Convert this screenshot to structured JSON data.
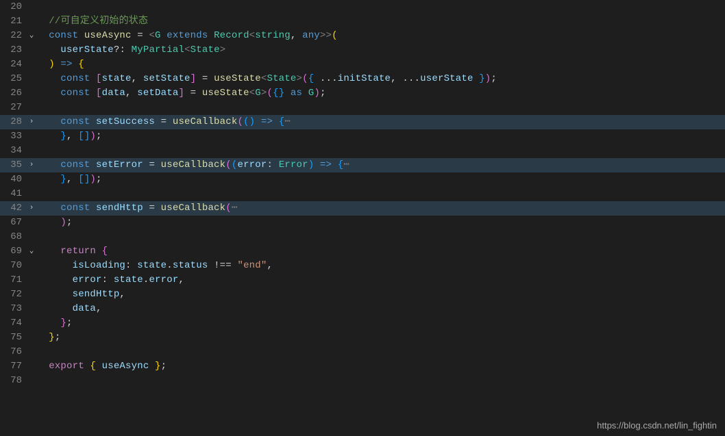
{
  "watermark": "https://blog.csdn.net/lin_fightin",
  "fold_icons": {
    "collapsed": "›",
    "expanded": "⌄"
  },
  "lines": [
    {
      "num": "20",
      "fold": "",
      "hl": false,
      "tokens": [
        [
          "",
          ""
        ]
      ]
    },
    {
      "num": "21",
      "fold": "",
      "hl": false,
      "tokens": [
        [
          "  ",
          ""
        ],
        [
          "//可自定义初始的状态",
          "c-comment"
        ]
      ]
    },
    {
      "num": "22",
      "fold": "expanded",
      "hl": false,
      "tokens": [
        [
          "  ",
          ""
        ],
        [
          "const ",
          "c-const"
        ],
        [
          "useAsync ",
          "c-func"
        ],
        [
          "= ",
          "c-punct"
        ],
        [
          "<",
          "c-gray"
        ],
        [
          "G ",
          "c-type"
        ],
        [
          "extends ",
          "c-const"
        ],
        [
          "Record",
          "c-type"
        ],
        [
          "<",
          "c-gray"
        ],
        [
          "string",
          "c-type"
        ],
        [
          ", ",
          "c-punct"
        ],
        [
          "any",
          "c-const"
        ],
        [
          ">>",
          "c-gray"
        ],
        [
          "(",
          "c-yellow"
        ]
      ]
    },
    {
      "num": "23",
      "fold": "",
      "hl": false,
      "tokens": [
        [
          "    ",
          ""
        ],
        [
          "userState",
          "c-var"
        ],
        [
          "?",
          "c-punct"
        ],
        [
          ": ",
          "c-punct"
        ],
        [
          "MyPartial",
          "c-type"
        ],
        [
          "<",
          "c-gray"
        ],
        [
          "State",
          "c-type"
        ],
        [
          ">",
          "c-gray"
        ]
      ]
    },
    {
      "num": "24",
      "fold": "",
      "hl": false,
      "tokens": [
        [
          "  ",
          ""
        ],
        [
          ") ",
          "c-yellow"
        ],
        [
          "=> ",
          "c-const"
        ],
        [
          "{",
          "c-yellow"
        ]
      ]
    },
    {
      "num": "25",
      "fold": "",
      "hl": false,
      "tokens": [
        [
          "    ",
          ""
        ],
        [
          "const ",
          "c-const"
        ],
        [
          "[",
          "c-magenta"
        ],
        [
          "state",
          "c-var"
        ],
        [
          ", ",
          "c-punct"
        ],
        [
          "setState",
          "c-var"
        ],
        [
          "] ",
          "c-magenta"
        ],
        [
          "= ",
          "c-punct"
        ],
        [
          "useState",
          "c-func"
        ],
        [
          "<",
          "c-gray"
        ],
        [
          "State",
          "c-type"
        ],
        [
          ">",
          "c-gray"
        ],
        [
          "(",
          "c-magenta"
        ],
        [
          "{ ",
          "c-cyan"
        ],
        [
          "...",
          "c-punct"
        ],
        [
          "initState",
          "c-var"
        ],
        [
          ", ",
          "c-punct"
        ],
        [
          "...",
          "c-punct"
        ],
        [
          "userState ",
          "c-var"
        ],
        [
          "}",
          "c-cyan"
        ],
        [
          ")",
          "c-magenta"
        ],
        [
          ";",
          "c-punct"
        ]
      ]
    },
    {
      "num": "26",
      "fold": "",
      "hl": false,
      "tokens": [
        [
          "    ",
          ""
        ],
        [
          "const ",
          "c-const"
        ],
        [
          "[",
          "c-magenta"
        ],
        [
          "data",
          "c-var"
        ],
        [
          ", ",
          "c-punct"
        ],
        [
          "setData",
          "c-var"
        ],
        [
          "] ",
          "c-magenta"
        ],
        [
          "= ",
          "c-punct"
        ],
        [
          "useState",
          "c-func"
        ],
        [
          "<",
          "c-gray"
        ],
        [
          "G",
          "c-type"
        ],
        [
          ">",
          "c-gray"
        ],
        [
          "(",
          "c-magenta"
        ],
        [
          "{} ",
          "c-cyan"
        ],
        [
          "as ",
          "c-const"
        ],
        [
          "G",
          "c-type"
        ],
        [
          ")",
          "c-magenta"
        ],
        [
          ";",
          "c-punct"
        ]
      ]
    },
    {
      "num": "27",
      "fold": "",
      "hl": false,
      "tokens": [
        [
          "",
          ""
        ]
      ]
    },
    {
      "num": "28",
      "fold": "collapsed",
      "hl": true,
      "tokens": [
        [
          "    ",
          ""
        ],
        [
          "const ",
          "c-const"
        ],
        [
          "setSuccess ",
          "c-var"
        ],
        [
          "= ",
          "c-punct"
        ],
        [
          "useCallback",
          "c-func"
        ],
        [
          "(",
          "c-magenta"
        ],
        [
          "() ",
          "c-cyan"
        ],
        [
          "=> ",
          "c-const"
        ],
        [
          "{",
          "c-cyan"
        ],
        [
          "⋯",
          "c-gray"
        ]
      ]
    },
    {
      "num": "33",
      "fold": "",
      "hl": false,
      "tokens": [
        [
          "    ",
          ""
        ],
        [
          "}",
          "c-cyan"
        ],
        [
          ", ",
          "c-punct"
        ],
        [
          "[]",
          "c-cyan"
        ],
        [
          ")",
          "c-magenta"
        ],
        [
          ";",
          "c-punct"
        ]
      ]
    },
    {
      "num": "34",
      "fold": "",
      "hl": false,
      "tokens": [
        [
          "",
          ""
        ]
      ]
    },
    {
      "num": "35",
      "fold": "collapsed",
      "hl": true,
      "tokens": [
        [
          "    ",
          ""
        ],
        [
          "const ",
          "c-const"
        ],
        [
          "setError ",
          "c-var"
        ],
        [
          "= ",
          "c-punct"
        ],
        [
          "useCallback",
          "c-func"
        ],
        [
          "(",
          "c-magenta"
        ],
        [
          "(",
          "c-cyan"
        ],
        [
          "error",
          "c-var"
        ],
        [
          ": ",
          "c-punct"
        ],
        [
          "Error",
          "c-type"
        ],
        [
          ") ",
          "c-cyan"
        ],
        [
          "=> ",
          "c-const"
        ],
        [
          "{",
          "c-cyan"
        ],
        [
          "⋯",
          "c-gray"
        ]
      ]
    },
    {
      "num": "40",
      "fold": "",
      "hl": false,
      "tokens": [
        [
          "    ",
          ""
        ],
        [
          "}",
          "c-cyan"
        ],
        [
          ", ",
          "c-punct"
        ],
        [
          "[]",
          "c-cyan"
        ],
        [
          ")",
          "c-magenta"
        ],
        [
          ";",
          "c-punct"
        ]
      ]
    },
    {
      "num": "41",
      "fold": "",
      "hl": false,
      "tokens": [
        [
          "",
          ""
        ]
      ]
    },
    {
      "num": "42",
      "fold": "collapsed",
      "hl": true,
      "tokens": [
        [
          "    ",
          ""
        ],
        [
          "const ",
          "c-const"
        ],
        [
          "sendHttp ",
          "c-var"
        ],
        [
          "= ",
          "c-punct"
        ],
        [
          "useCallback",
          "c-func"
        ],
        [
          "(",
          "c-magenta"
        ],
        [
          "⋯",
          "c-gray"
        ]
      ]
    },
    {
      "num": "67",
      "fold": "",
      "hl": false,
      "tokens": [
        [
          "    ",
          ""
        ],
        [
          ")",
          "c-magenta"
        ],
        [
          ";",
          "c-punct"
        ]
      ]
    },
    {
      "num": "68",
      "fold": "",
      "hl": false,
      "tokens": [
        [
          "",
          ""
        ]
      ]
    },
    {
      "num": "69",
      "fold": "expanded",
      "hl": false,
      "tokens": [
        [
          "    ",
          ""
        ],
        [
          "return ",
          "c-keyword"
        ],
        [
          "{",
          "c-magenta"
        ]
      ]
    },
    {
      "num": "70",
      "fold": "",
      "hl": false,
      "tokens": [
        [
          "      ",
          ""
        ],
        [
          "isLoading",
          "c-prop"
        ],
        [
          ": ",
          "c-punct"
        ],
        [
          "state",
          "c-var"
        ],
        [
          ".",
          "c-punct"
        ],
        [
          "status ",
          "c-prop"
        ],
        [
          "!== ",
          "c-punct"
        ],
        [
          "\"end\"",
          "c-string"
        ],
        [
          ",",
          "c-punct"
        ]
      ]
    },
    {
      "num": "71",
      "fold": "",
      "hl": false,
      "tokens": [
        [
          "      ",
          ""
        ],
        [
          "error",
          "c-prop"
        ],
        [
          ": ",
          "c-punct"
        ],
        [
          "state",
          "c-var"
        ],
        [
          ".",
          "c-punct"
        ],
        [
          "error",
          "c-prop"
        ],
        [
          ",",
          "c-punct"
        ]
      ]
    },
    {
      "num": "72",
      "fold": "",
      "hl": false,
      "tokens": [
        [
          "      ",
          ""
        ],
        [
          "sendHttp",
          "c-var"
        ],
        [
          ",",
          "c-punct"
        ]
      ]
    },
    {
      "num": "73",
      "fold": "",
      "hl": false,
      "tokens": [
        [
          "      ",
          ""
        ],
        [
          "data",
          "c-var"
        ],
        [
          ",",
          "c-punct"
        ]
      ]
    },
    {
      "num": "74",
      "fold": "",
      "hl": false,
      "tokens": [
        [
          "    ",
          ""
        ],
        [
          "}",
          "c-magenta"
        ],
        [
          ";",
          "c-punct"
        ]
      ]
    },
    {
      "num": "75",
      "fold": "",
      "hl": false,
      "tokens": [
        [
          "  ",
          ""
        ],
        [
          "}",
          "c-yellow"
        ],
        [
          ";",
          "c-punct"
        ]
      ]
    },
    {
      "num": "76",
      "fold": "",
      "hl": false,
      "tokens": [
        [
          "",
          ""
        ]
      ]
    },
    {
      "num": "77",
      "fold": "",
      "hl": false,
      "tokens": [
        [
          "  ",
          ""
        ],
        [
          "export ",
          "c-keyword"
        ],
        [
          "{ ",
          "c-yellow"
        ],
        [
          "useAsync ",
          "c-var"
        ],
        [
          "}",
          "c-yellow"
        ],
        [
          ";",
          "c-punct"
        ]
      ]
    },
    {
      "num": "78",
      "fold": "",
      "hl": false,
      "tokens": [
        [
          "",
          ""
        ]
      ]
    }
  ]
}
